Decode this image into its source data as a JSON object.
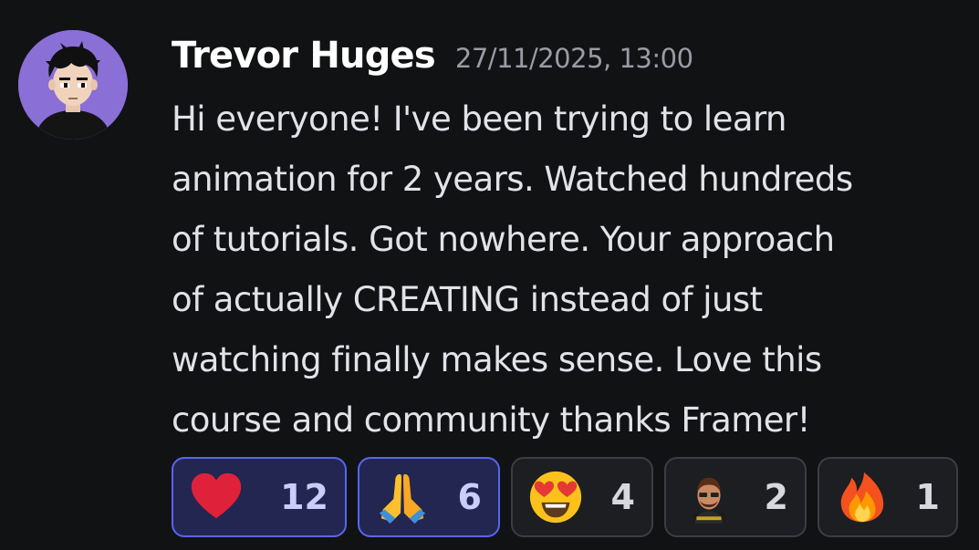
{
  "message": {
    "author": "Trevor Huges",
    "timestamp": "27/11/2025, 13:00",
    "lines": [
      "Hi everyone! I've been trying to learn",
      "animation for 2 years. Watched hundreds",
      "of tutorials. Got nowhere. Your approach",
      "of actually CREATING instead of just",
      "watching finally makes sense. Love this",
      "course and community thanks Framer!"
    ]
  },
  "reactions": [
    {
      "emoji": "red-heart-icon",
      "count": "12",
      "active": true
    },
    {
      "emoji": "folded-hands-icon",
      "count": "6",
      "active": true
    },
    {
      "emoji": "heart-eyes-face-icon",
      "count": "4",
      "active": false
    },
    {
      "emoji": "custom-avatar-emoji-icon",
      "count": "2",
      "active": false
    },
    {
      "emoji": "fire-icon",
      "count": "1",
      "active": false
    }
  ],
  "colors": {
    "background": "#111214",
    "accent": "#5865f2",
    "avatar_bg": "#8a6fd6"
  }
}
